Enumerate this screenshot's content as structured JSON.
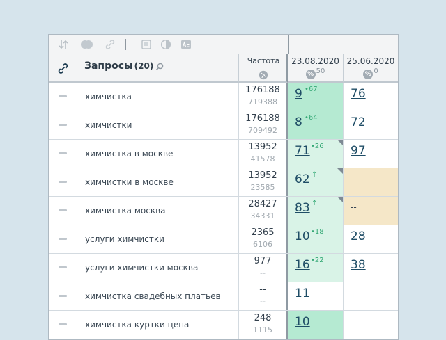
{
  "header": {
    "queries_title": "Запросы",
    "queries_count": "(20)",
    "frequency_title": "Частота",
    "date1": "23.08.2020",
    "date1_sub": "50",
    "date2": "25.06.2020",
    "date2_sub": "0"
  },
  "colors": {
    "d1_top": "#b5ead2",
    "d1_light": "#d9f3e7",
    "d2_miss": "#f5e7c8",
    "grid": "#d3dae0"
  },
  "rows": [
    {
      "query": "химчистка",
      "freq": "176188",
      "freq_sub": "719388",
      "d1_pos": "9",
      "d1_delta": "•67",
      "d2_pos": "76"
    },
    {
      "query": "химчистки",
      "freq": "176188",
      "freq_sub": "709492",
      "d1_pos": "8",
      "d1_delta": "•64",
      "d2_pos": "72"
    },
    {
      "query": "химчистка в москве",
      "freq": "13952",
      "freq_sub": "41578",
      "d1_pos": "71",
      "d1_delta": "•26",
      "d2_pos": "97"
    },
    {
      "query": "химчистки в москве",
      "freq": "13952",
      "freq_sub": "23585",
      "d1_pos": "62",
      "d1_delta": "↑",
      "d2_pos": "--"
    },
    {
      "query": "химчистка москва",
      "freq": "28427",
      "freq_sub": "34331",
      "d1_pos": "83",
      "d1_delta": "↑",
      "d2_pos": "--"
    },
    {
      "query": "услуги химчистки",
      "freq": "2365",
      "freq_sub": "6106",
      "d1_pos": "10",
      "d1_delta": "•18",
      "d2_pos": "28"
    },
    {
      "query": "услуги химчистки москва",
      "freq": "977",
      "freq_sub": "--",
      "d1_pos": "16",
      "d1_delta": "•22",
      "d2_pos": "38"
    },
    {
      "query": "химчистка свадебных платьев",
      "freq": "--",
      "freq_sub": "--",
      "d1_pos": "11",
      "d1_delta": "",
      "d2_pos": ""
    },
    {
      "query": "химчистка куртки цена",
      "freq": "248",
      "freq_sub": "1115",
      "d1_pos": "10",
      "d1_delta": "",
      "d2_pos": ""
    }
  ]
}
